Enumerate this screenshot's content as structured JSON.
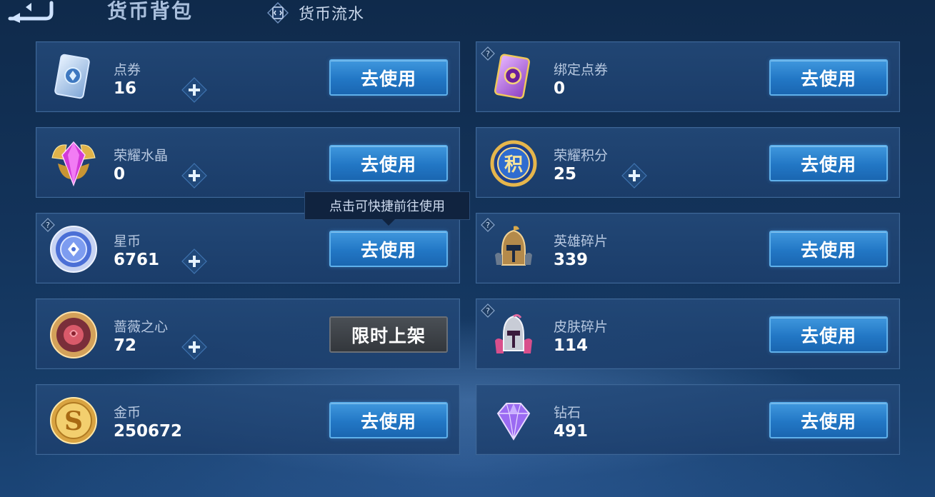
{
  "header": {
    "title": "货币背包",
    "flow_label": "货币流水"
  },
  "tooltip": "点击可快捷前往使用",
  "cards": [
    {
      "id": "points",
      "name": "点券",
      "count": "16",
      "button": "去使用"
    },
    {
      "id": "bound-points",
      "name": "绑定点券",
      "count": "0",
      "button": "去使用"
    },
    {
      "id": "glory-crystal",
      "name": "荣耀水晶",
      "count": "0",
      "button": "去使用"
    },
    {
      "id": "glory-score",
      "name": "荣耀积分",
      "count": "25",
      "button": "去使用"
    },
    {
      "id": "star-coin",
      "name": "星币",
      "count": "6761",
      "button": "去使用"
    },
    {
      "id": "hero-shard",
      "name": "英雄碎片",
      "count": "339",
      "button": "去使用"
    },
    {
      "id": "rose-heart",
      "name": "蔷薇之心",
      "count": "72",
      "button": "限时上架"
    },
    {
      "id": "skin-shard",
      "name": "皮肤碎片",
      "count": "114",
      "button": "去使用"
    },
    {
      "id": "gold",
      "name": "金币",
      "count": "250672",
      "button": "去使用"
    },
    {
      "id": "diamond",
      "name": "钻石",
      "count": "491",
      "button": "去使用"
    }
  ],
  "icon_glyphs": {
    "glory_score": "积"
  },
  "colors": {
    "accent_button": "#2277c5",
    "card_border": "#3e6797",
    "disabled_button": "#33373c"
  }
}
